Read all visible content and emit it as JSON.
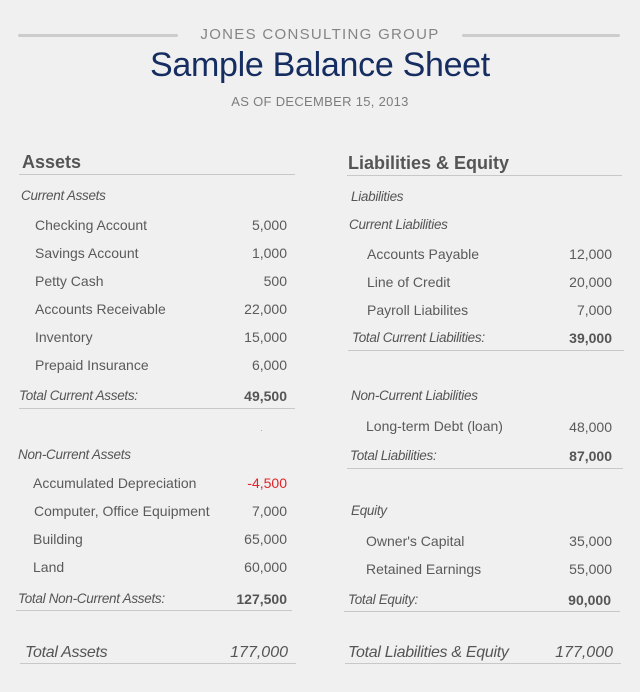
{
  "header": {
    "company": "JONES CONSULTING GROUP",
    "title": "Sample Balance Sheet",
    "date": "AS OF DECEMBER 15, 2013"
  },
  "assets": {
    "title": "Assets",
    "current": {
      "label": "Current Assets",
      "items": [
        {
          "name": "Checking Account",
          "value": "5,000"
        },
        {
          "name": "Savings Account",
          "value": "1,000"
        },
        {
          "name": "Petty Cash",
          "value": "500"
        },
        {
          "name": "Accounts Receivable",
          "value": "22,000"
        },
        {
          "name": "Inventory",
          "value": "15,000"
        },
        {
          "name": "Prepaid Insurance",
          "value": "6,000"
        }
      ],
      "total_label": "Total Current Assets:",
      "total_value": "49,500"
    },
    "non_current": {
      "label": "Non-Current Assets",
      "items": [
        {
          "name": "Accumulated Depreciation",
          "value": "-4,500"
        },
        {
          "name": "Computer, Office Equipment",
          "value": "7,000"
        },
        {
          "name": "Building",
          "value": "65,000"
        },
        {
          "name": "Land",
          "value": "60,000"
        }
      ],
      "total_label": "Total Non-Current Assets:",
      "total_value": "127,500"
    },
    "grand_total_label": "Total Assets",
    "grand_total_value": "177,000"
  },
  "liabilities_equity": {
    "title": "Liabilities & Equity",
    "liabilities_label": "Liabilities",
    "current": {
      "label": "Current Liabilities",
      "items": [
        {
          "name": "Accounts Payable",
          "value": "12,000"
        },
        {
          "name": "Line of Credit",
          "value": "20,000"
        },
        {
          "name": "Payroll Liabilites",
          "value": "7,000"
        }
      ],
      "total_label": "Total Current Liabilities:",
      "total_value": "39,000"
    },
    "non_current": {
      "label": "Non-Current Liabilities",
      "items": [
        {
          "name": "Long-term Debt (loan)",
          "value": "48,000"
        }
      ],
      "total_label": "Total Liabilities:",
      "total_value": "87,000"
    },
    "equity": {
      "label": "Equity",
      "items": [
        {
          "name": "Owner's Capital",
          "value": "35,000"
        },
        {
          "name": "Retained Earnings",
          "value": "55,000"
        }
      ],
      "total_label": "Total Equity:",
      "total_value": "90,000"
    },
    "grand_total_label": "Total Liabilities & Equity",
    "grand_total_value": "177,000"
  },
  "colors": {
    "title": "#162d61",
    "negative": "#e0242b",
    "background": "#f0f0f0"
  }
}
